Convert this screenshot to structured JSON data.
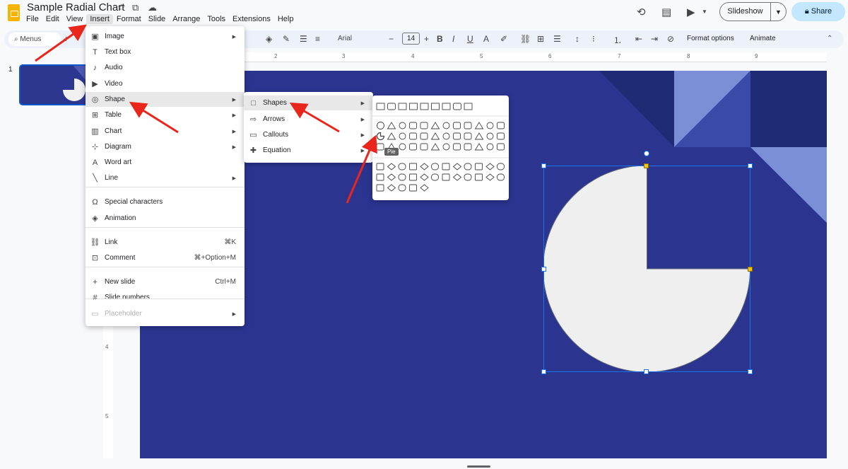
{
  "app": {
    "title": "Sample Radial Chart",
    "menubar": [
      "File",
      "Edit",
      "View",
      "Insert",
      "Format",
      "Slide",
      "Arrange",
      "Tools",
      "Extensions",
      "Help"
    ],
    "active_menu": "Insert",
    "slideshow_label": "Slideshow",
    "share_label": "Share"
  },
  "toolbar": {
    "menus_label": "Menus",
    "font_name": "Arial",
    "font_size": "14",
    "format_options": "Format options",
    "animate": "Animate"
  },
  "ruler": {
    "h_numbers": [
      "2",
      "3",
      "4",
      "5",
      "6",
      "7",
      "8",
      "9"
    ],
    "v_numbers": [
      "4",
      "5"
    ]
  },
  "filmstrip": {
    "slide_number": "1"
  },
  "insert_menu": {
    "items": [
      {
        "label": "Image",
        "icon": "image-icon",
        "submenu": true
      },
      {
        "label": "Text box",
        "icon": "textbox-icon",
        "submenu": false
      },
      {
        "label": "Audio",
        "icon": "audio-icon",
        "submenu": false
      },
      {
        "label": "Video",
        "icon": "video-icon",
        "submenu": false
      },
      {
        "label": "Shape",
        "icon": "shape-icon",
        "submenu": true,
        "highlighted": true
      },
      {
        "label": "Table",
        "icon": "table-icon",
        "submenu": true
      },
      {
        "label": "Chart",
        "icon": "chart-icon",
        "submenu": true
      },
      {
        "label": "Diagram",
        "icon": "diagram-icon",
        "submenu": true
      },
      {
        "label": "Word art",
        "icon": "wordart-icon",
        "submenu": false
      },
      {
        "label": "Line",
        "icon": "line-icon",
        "submenu": true
      },
      {
        "label": "Special characters",
        "icon": "omega-icon",
        "submenu": false
      },
      {
        "label": "Animation",
        "icon": "animation-icon",
        "submenu": false
      },
      {
        "label": "Link",
        "icon": "link-icon",
        "shortcut": "⌘K"
      },
      {
        "label": "Comment",
        "icon": "comment-icon",
        "shortcut": "⌘+Option+M"
      },
      {
        "label": "New slide",
        "icon": "plus-icon",
        "shortcut": "Ctrl+M"
      },
      {
        "label": "Slide numbers",
        "icon": "hash-icon",
        "submenu": false
      },
      {
        "label": "Placeholder",
        "icon": "placeholder-icon",
        "submenu": true,
        "disabled": true
      }
    ]
  },
  "shape_menu": {
    "items": [
      {
        "label": "Shapes",
        "icon": "square-icon",
        "highlighted": true
      },
      {
        "label": "Arrows",
        "icon": "arrow-right-icon"
      },
      {
        "label": "Callouts",
        "icon": "callout-icon"
      },
      {
        "label": "Equation",
        "icon": "equation-plus-icon"
      }
    ]
  },
  "shapes_panel": {
    "tooltip": "Pie"
  },
  "colors": {
    "slide_bg": "#2b3590",
    "accent": "#0b57d0",
    "share_bg": "#c2e7ff",
    "pie_fill": "#efefef",
    "arrow": "#e8261c"
  }
}
